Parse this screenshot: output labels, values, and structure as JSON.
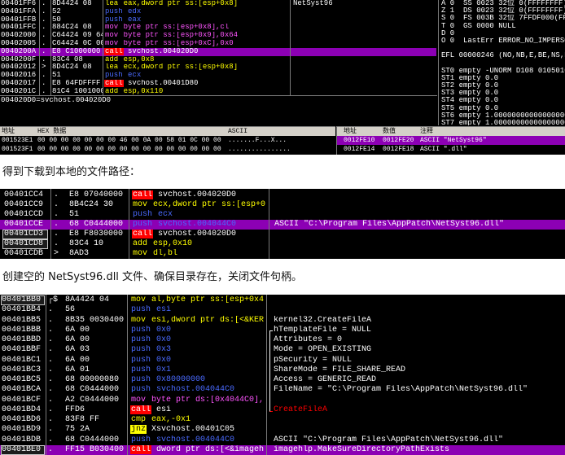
{
  "colors": {
    "selection": "#8c00b4",
    "call": "#ff0000",
    "push": "#4a6aff",
    "mov": "#ffff00",
    "mem": "#ff55ff",
    "jmp": "#ffff00"
  },
  "captions": {
    "c1": "得到下载到本地的文件路径：",
    "c2": "创建空的 NetSyst96.dll 文件、确保目录存在，关闭文件句柄。"
  },
  "panel1": {
    "rows": [
      {
        "addr": "00401FF6",
        "mark": ".",
        "bytes": "8D4424 08",
        "op": "lea",
        "args": "eax,dword ptr ss:[esp+0x8]",
        "comment": "NetSyst96"
      },
      {
        "addr": "00401FFA",
        "mark": ".",
        "bytes": "52",
        "op": "push",
        "args": "edx"
      },
      {
        "addr": "00401FFB",
        "mark": ".",
        "bytes": "50",
        "op": "push",
        "args": "eax"
      },
      {
        "addr": "00401FFC",
        "mark": ".",
        "bytes": "884C24 08",
        "op": "mov",
        "args": "byte ptr ss:[esp+0x8],cl",
        "memWrite": true
      },
      {
        "addr": "00402000",
        "mark": ".",
        "bytes": "C64424 09 64",
        "op": "mov",
        "args": "byte ptr ss:[esp+0x9],0x64",
        "memWrite": true
      },
      {
        "addr": "00402005",
        "mark": ".",
        "bytes": "C64424 0C 00",
        "op": "mov",
        "args": "byte ptr ss:[esp+0xC],0x0",
        "memWrite": true
      },
      {
        "addr": "0040200A",
        "mark": ".",
        "bytes": "E8 C1000000",
        "op": "call",
        "args": "svchost.004020D0",
        "selected": true
      },
      {
        "addr": "0040200F",
        "mark": ".",
        "bytes": "83C4 08",
        "op": "add",
        "args": "esp,0x8"
      },
      {
        "addr": "00402012",
        "mark": ">",
        "bytes": "8D4C24 08",
        "op": "lea",
        "args": "ecx,dword ptr ss:[esp+0x8]"
      },
      {
        "addr": "00402016",
        "mark": ".",
        "bytes": "51",
        "op": "push",
        "args": "ecx"
      },
      {
        "addr": "00402017",
        "mark": ".",
        "bytes": "E8 64FDFFFF",
        "op": "call",
        "args": "svchost.00401D80"
      },
      {
        "addr": "0040201C",
        "mark": ".",
        "bytes": "81C4 1001000",
        "op": "add",
        "args": "esp,0x110"
      }
    ],
    "info": "004020D0=svchost.004020D0",
    "registers": [
      "A 0  SS 0023 32位 0(FFFFFFFF)",
      "Z 1  DS 0023 32位 0(FFFFFFFF)",
      "S 0  FS 003B 32位 7FFDF000(FFF)",
      "T 0  GS 0000 NULL",
      "D 0",
      "O 0  LastErr ERROR_NO_IMPERSONA",
      "",
      "EFL 00000246 (NO,NB,E,BE,NS,PE,",
      "",
      "ST0 empty -UNORM D108 01050104",
      "ST1 empty 0.0",
      "ST2 empty 0.0",
      "ST3 empty 0.0",
      "ST4 empty 0.0",
      "ST5 empty 0.0",
      "ST6 empty 1.0000000000000000000",
      "ST7 empty 1.0000000000000000000"
    ],
    "dump": {
      "headers": {
        "addr": "地址",
        "hex": "HEX 数据",
        "ascii": "ASCII"
      },
      "rows": [
        {
          "addr": "001523E1",
          "hex": "00 00 00 00 00 00 00 46 00 0A 00 58 01 0C 00 00",
          "ascii": ".......F...X..."
        },
        {
          "addr": "001523F1",
          "hex": "00 00 00 00 00 00 00 00 00 00 00 00 00 00 00 00",
          "ascii": "................"
        }
      ]
    },
    "stack": {
      "headers": {
        "addr": "地址",
        "val": "数值",
        "comment": "注释"
      },
      "rows": [
        {
          "addr": "0012FE10",
          "val": "0012FE20",
          "comment": "ASCII \"NetSyst96\"",
          "selected": true
        },
        {
          "addr": "0012FE14",
          "val": "0012FE18",
          "comment": "ASCII \".dll\""
        }
      ]
    }
  },
  "panel2": {
    "rows": [
      {
        "addr": "00401CC4",
        "mark": ".",
        "bytes": "E8 07040000",
        "op": "call",
        "args": "svchost.004020D0"
      },
      {
        "addr": "00401CC9",
        "mark": ".",
        "bytes": "8B4C24 30",
        "op": "mov",
        "args": "ecx,dword ptr ss:[esp+0"
      },
      {
        "addr": "00401CCD",
        "mark": ".",
        "bytes": "51",
        "op": "push",
        "args": "ecx"
      },
      {
        "addr": "00401CCE",
        "mark": ".",
        "bytes": "68 C0444000",
        "op": "push",
        "args": "svchost.004044C0",
        "comment": "ASCII \"C:\\Program Files\\AppPatch\\NetSyst96.dll\"",
        "selected": true
      },
      {
        "addr": "00401CD3",
        "mark": ".",
        "bytes": "E8 F8030000",
        "op": "call",
        "args": "svchost.004020D0",
        "addrBox": true
      },
      {
        "addr": "00401CD8",
        "mark": ".",
        "bytes": "83C4 10",
        "op": "add",
        "args": "esp,0x10",
        "addrBox": true
      },
      {
        "addr": "00401CDB",
        "mark": ">",
        "bytes": "8AD3",
        "op": "mov",
        "args": "dl,bl"
      }
    ]
  },
  "panel3": {
    "rows": [
      {
        "addr": "00401BB0",
        "mark": "┌$",
        "bytes": "8A4424 04",
        "op": "mov",
        "args": "al,byte ptr ss:[esp+0x4",
        "addrBox": true
      },
      {
        "addr": "00401BB4",
        "mark": ".",
        "bytes": "56",
        "op": "push",
        "args": "esi"
      },
      {
        "addr": "00401BB5",
        "mark": ".",
        "bytes": "8B35 0030400",
        "op": "mov",
        "args": "esi,dword ptr ds:[<&KER",
        "comment": "kernel32.CreateFileA"
      },
      {
        "addr": "00401BBB",
        "mark": ".",
        "bytes": "6A 00",
        "op": "push",
        "args": "0x0",
        "comment": "hTemplateFile = NULL"
      },
      {
        "addr": "00401BBD",
        "mark": ".",
        "bytes": "6A 00",
        "op": "push",
        "args": "0x0",
        "comment": "Attributes = 0"
      },
      {
        "addr": "00401BBF",
        "mark": ".",
        "bytes": "6A 03",
        "op": "push",
        "args": "0x3",
        "comment": "Mode = OPEN_EXISTING"
      },
      {
        "addr": "00401BC1",
        "mark": ".",
        "bytes": "6A 00",
        "op": "push",
        "args": "0x0",
        "comment": "pSecurity = NULL"
      },
      {
        "addr": "00401BC3",
        "mark": ".",
        "bytes": "6A 01",
        "op": "push",
        "args": "0x1",
        "comment": "ShareMode = FILE_SHARE_READ"
      },
      {
        "addr": "00401BC5",
        "mark": ".",
        "bytes": "68 00000080",
        "op": "push",
        "args": "0x80000000",
        "comment": "Access = GENERIC_READ"
      },
      {
        "addr": "00401BCA",
        "mark": ".",
        "bytes": "68 C0444000",
        "op": "push",
        "args": "svchost.004044C0",
        "comment": "FileName = \"C:\\Program Files\\AppPatch\\NetSyst96.dll\""
      },
      {
        "addr": "00401BCF",
        "mark": ".",
        "bytes": "A2 C0444000",
        "op": "mov",
        "args": "byte ptr ds:[0x4044C0],",
        "memWrite": true
      },
      {
        "addr": "00401BD4",
        "mark": ".",
        "bytes": "FFD6",
        "op": "call",
        "args": "esi",
        "comment": "CreateFileA",
        "commentRed": true
      },
      {
        "addr": "00401BD6",
        "mark": ".",
        "bytes": "83F8 FF",
        "op": "cmp",
        "args": "eax,-0x1"
      },
      {
        "addr": "00401BD9",
        "mark": ".",
        "bytes": "75 2A",
        "op": "jnz",
        "args": "Xsvchost.00401C05"
      },
      {
        "addr": "00401BDB",
        "mark": ".",
        "bytes": "68 C0444000",
        "op": "push",
        "args": "svchost.004044C0",
        "comment": "ASCII \"C:\\Program Files\\AppPatch\\NetSyst96.dll\""
      },
      {
        "addr": "00401BE0",
        "mark": ".",
        "bytes": "FF15 B030400",
        "op": "call",
        "args": "dword ptr ds:[<&imageh",
        "comment": "imagehlp.MakeSureDirectoryPathExists",
        "selected": true,
        "addrBox": true
      }
    ]
  }
}
